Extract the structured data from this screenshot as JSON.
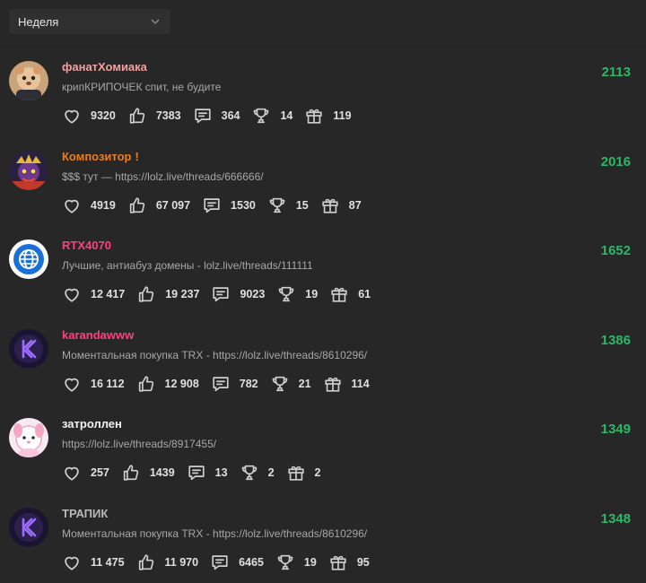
{
  "filter": {
    "period": "Неделя"
  },
  "users": [
    {
      "name": "фанатХомиака",
      "name_color": "#f3a0a0",
      "status": "крипКРИПОЧЕК спит, не будите",
      "score": "2113",
      "likes": "9320",
      "thumbs": "7383",
      "messages": "364",
      "trophies": "14",
      "gifts": "119"
    },
    {
      "name": "Композитор",
      "name_color": "#e67e22",
      "badge": "!",
      "status": "$$$ тут — https://lolz.live/threads/666666/",
      "score": "2016",
      "likes": "4919",
      "thumbs": "67 097",
      "messages": "1530",
      "trophies": "15",
      "gifts": "87"
    },
    {
      "name": "RTX4070",
      "name_color": "#ff3f7f",
      "status": "Лучшие, антиабуз домены - lolz.live/threads/111111",
      "score": "1652",
      "likes": "12 417",
      "thumbs": "19 237",
      "messages": "9023",
      "trophies": "19",
      "gifts": "61"
    },
    {
      "name": "karandawww",
      "name_color": "#ff3f7f",
      "status": "Моментальная покупка TRX - https://lolz.live/threads/8610296/",
      "score": "1386",
      "likes": "16 112",
      "thumbs": "12 908",
      "messages": "782",
      "trophies": "21",
      "gifts": "114"
    },
    {
      "name": "затроллен",
      "name_color": "#f2f2f2",
      "status": "https://lolz.live/threads/8917455/",
      "score": "1349",
      "likes": "257",
      "thumbs": "1439",
      "messages": "13",
      "trophies": "2",
      "gifts": "2"
    },
    {
      "name": "ТРАПИК",
      "name_color": "#b9b9b9",
      "status": "Моментальная покупка TRX - https://lolz.live/threads/8610296/",
      "score": "1348",
      "likes": "11 475",
      "thumbs": "11 970",
      "messages": "6465",
      "trophies": "19",
      "gifts": "95"
    }
  ],
  "icons": {
    "like": "heart-icon",
    "thumb": "thumbs-up-icon",
    "message": "message-icon",
    "trophy": "trophy-icon",
    "gift": "gift-icon",
    "dropdown": "chevron-down-icon"
  },
  "colors": {
    "score": "#2bb866",
    "background": "#272727",
    "icon": "#cfcfcf"
  }
}
